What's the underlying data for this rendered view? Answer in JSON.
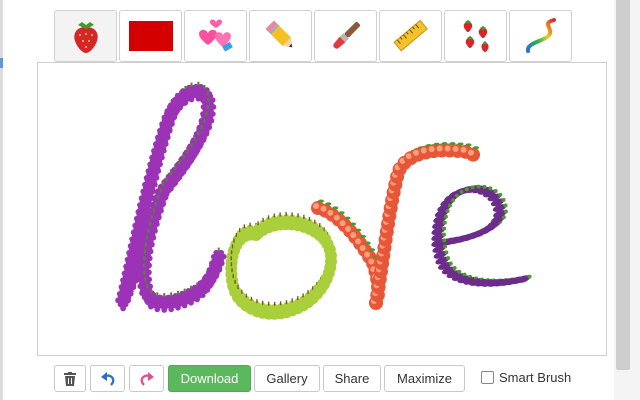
{
  "toolbar": {
    "tools": [
      {
        "icon": "strawberry-icon"
      },
      {
        "icon": "red-rectangle-icon"
      },
      {
        "icon": "hearts-icon"
      },
      {
        "icon": "pencil-icon"
      },
      {
        "icon": "paintbrush-icon"
      },
      {
        "icon": "ruler-icon"
      },
      {
        "icon": "strawberries-scatter-icon"
      },
      {
        "icon": "gradient-line-icon"
      }
    ]
  },
  "canvas": {
    "drawing": "love",
    "colors": {
      "grapes": "#9c33b6",
      "pears": "#a9cf3a",
      "peaches": "#e8563a",
      "eggplants": "#6b2c8a"
    }
  },
  "actions": {
    "delete_icon": "trash-icon",
    "undo_icon": "undo-icon",
    "redo_icon": "redo-icon",
    "download_label": "Download",
    "gallery_label": "Gallery",
    "share_label": "Share",
    "maximize_label": "Maximize",
    "smart_brush_label": "Smart Brush",
    "smart_brush_checked": false,
    "accent_green": "#5cb85c"
  }
}
